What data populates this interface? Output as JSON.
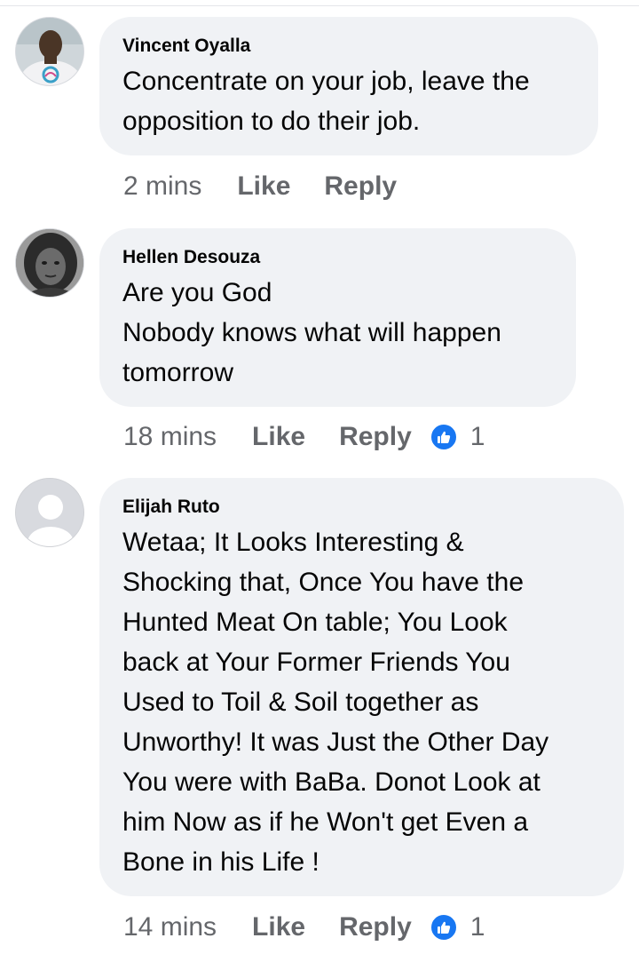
{
  "comments": [
    {
      "author": "Vincent Oyalla",
      "text_lines": [
        "Concentrate on your job, leave the",
        "opposition to do their job."
      ],
      "time": "2 mins",
      "like_label": "Like",
      "reply_label": "Reply",
      "reaction_count": ""
    },
    {
      "author": "Hellen Desouza",
      "text_lines": [
        "Are you God",
        "Nobody knows what will happen",
        "tomorrow"
      ],
      "time": "18 mins",
      "like_label": "Like",
      "reply_label": "Reply",
      "reaction_count": "1"
    },
    {
      "author": "Elijah Ruto",
      "text_lines": [
        "Wetaa; It Looks Interesting &",
        "Shocking that, Once You have the",
        "Hunted Meat On table; You Look",
        "back at Your Former Friends You",
        "Used to Toil & Soil together as",
        "Unworthy! It was Just the Other Day",
        "You were with BaBa. Donot Look at",
        "him Now as if he Won't get Even a",
        "Bone in his Life !"
      ],
      "time": "14 mins",
      "like_label": "Like",
      "reply_label": "Reply",
      "reaction_count": "1"
    }
  ],
  "colors": {
    "bubble": "#f0f2f5",
    "meta_text": "#65676b",
    "like_reaction": "#1877f2"
  },
  "icons": {
    "reaction": "thumbs-up-icon",
    "default_avatar": "default-avatar-icon"
  }
}
